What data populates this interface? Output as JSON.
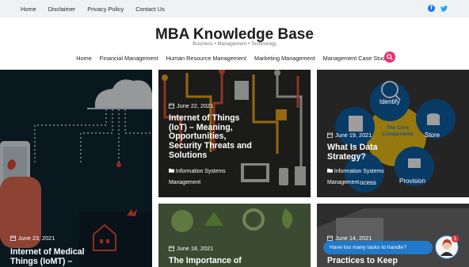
{
  "topbar": {
    "links": [
      "Home",
      "Disclaimer",
      "Privacy Policy",
      "Contact Us"
    ],
    "social": [
      "facebook-icon",
      "twitter-icon"
    ]
  },
  "site": {
    "title": "MBA Knowledge Base",
    "tagline": "Business • Management • Technology"
  },
  "nav": {
    "items": [
      "Home",
      "Financial Management",
      "Human Resource Management",
      "Marketing Management",
      "Management Case Studies"
    ],
    "search_icon": "search-icon"
  },
  "posts": [
    {
      "date": "June 23, 2021",
      "title": "Internet of Medical Things (IoMT) –",
      "category": ""
    },
    {
      "date": "June 22, 2021",
      "title": "Internet of Things (IoT) – Meaning, Opportunities, Security Threats and Solutions",
      "category": "Information Systems Management"
    },
    {
      "date": "June 19, 2021",
      "title": "What Is Data Strategy?",
      "category": "Information Systems Management"
    },
    {
      "date": "June 18, 2021",
      "title": "The Importance of",
      "category": ""
    },
    {
      "date": "June 14, 2021",
      "title": "Practices to Keep",
      "category": ""
    }
  ],
  "graphic_labels": {
    "identify": "Identify",
    "store": "Store",
    "provision": "Provision",
    "process": "ocess",
    "core": "The Core Components"
  },
  "chat": {
    "message": "Have too many tasks to handle?",
    "badge": "1"
  },
  "colors": {
    "accent": "#e8336f",
    "facebook": "#1877f2",
    "twitter": "#1da1f2",
    "chat": "#2279c7"
  }
}
